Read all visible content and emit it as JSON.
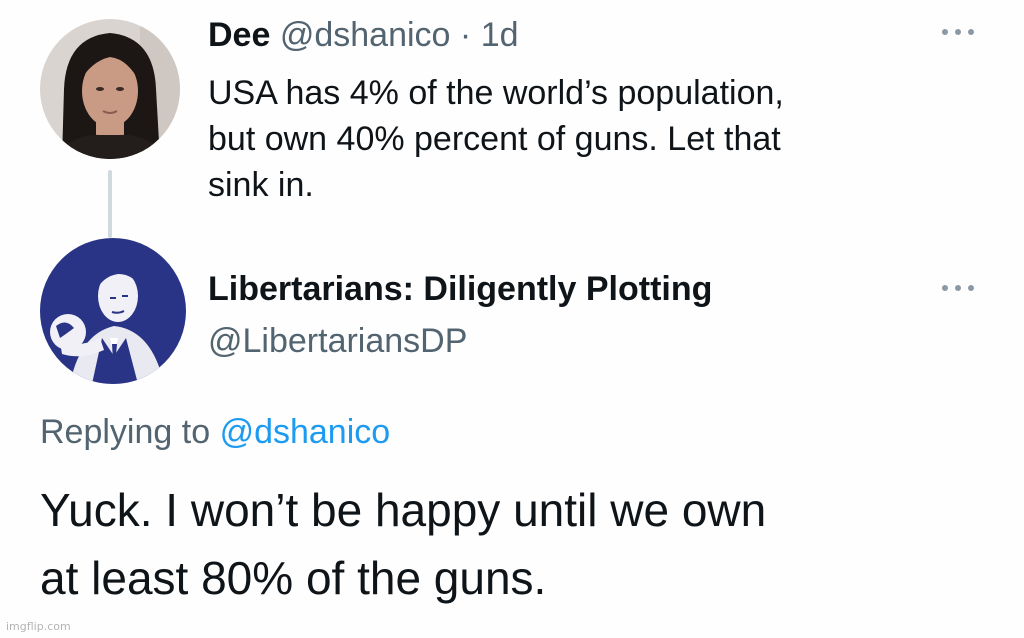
{
  "tweet": {
    "author_name": "Dee",
    "handle": "@dshanico",
    "separator": "·",
    "time": "1d",
    "text_line1": "USA has 4% of the world’s population,",
    "text_line2": "but own 40% percent of guns. Let that",
    "text_line3": "sink in."
  },
  "reply": {
    "author_name": "Libertarians: Diligently Plotting",
    "handle": "@LibertariansDP",
    "replying_prefix": "Replying to",
    "replying_handle": "@dshanico",
    "text_line1": "Yuck. I won’t be happy until we own",
    "text_line2": "at least 80% of the guns."
  },
  "watermark": "imgflip.com",
  "icons": {
    "more": "more-options-icon"
  },
  "colors": {
    "primary_text": "#0f1419",
    "secondary_text": "#536471",
    "link": "#1d9bf0",
    "thread_line": "#cfd9de",
    "avatar2_bg": "#2a3486"
  }
}
